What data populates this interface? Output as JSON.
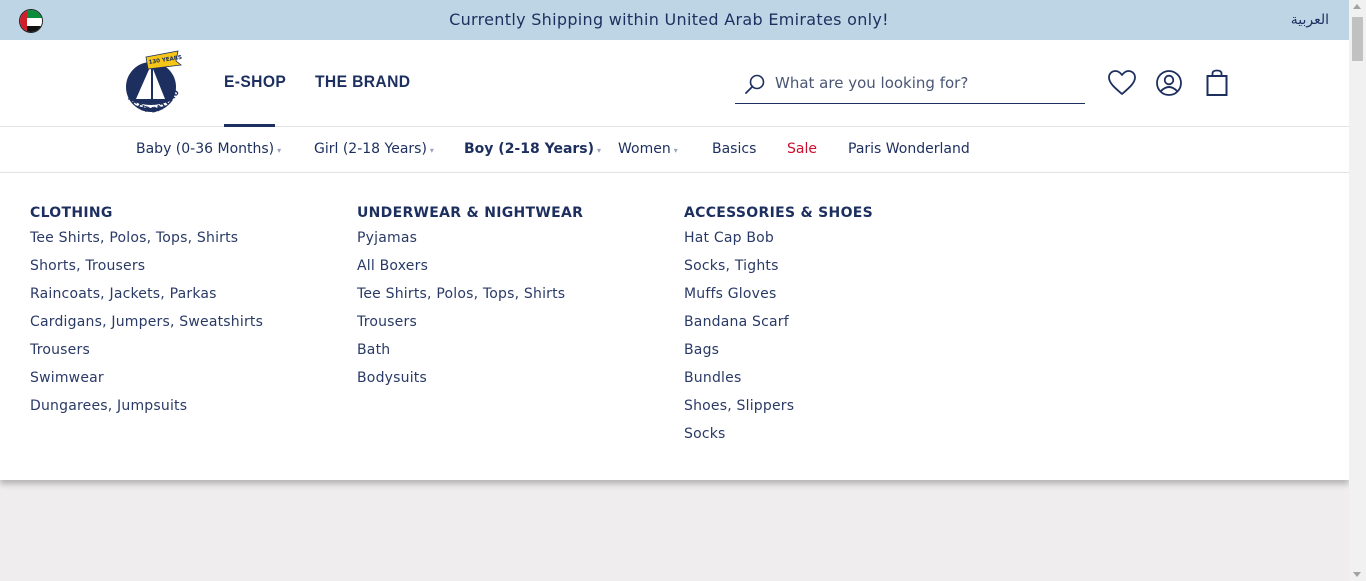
{
  "topbar": {
    "shipping_notice": "Currently Shipping within United Arab Emirates only!",
    "language_link": "العربية",
    "flag_icon": "uae-flag-icon"
  },
  "header": {
    "logo_text": "PETIT BATEAU",
    "logo_badge": "130 YEARS",
    "nav": [
      {
        "label": "E-SHOP",
        "active": true
      },
      {
        "label": "THE BRAND",
        "active": false
      }
    ],
    "search": {
      "placeholder": "What are you looking for?",
      "value": ""
    },
    "icons": [
      "search-icon",
      "wishlist-heart-icon",
      "account-icon",
      "cart-bag-icon"
    ]
  },
  "categories": [
    {
      "label": "Baby (0-36 Months)",
      "active": false,
      "has_dropdown": true
    },
    {
      "label": "Girl (2-18 Years)",
      "active": false,
      "has_dropdown": true
    },
    {
      "label": "Boy (2-18 Years)",
      "active": true,
      "has_dropdown": true
    },
    {
      "label": "Women",
      "active": false,
      "has_dropdown": true
    },
    {
      "label": "Basics",
      "active": false,
      "has_dropdown": false
    },
    {
      "label": "Sale",
      "active": false,
      "has_dropdown": false
    },
    {
      "label": "Paris Wonderland",
      "active": false,
      "has_dropdown": false
    }
  ],
  "mega_menu": {
    "columns": [
      {
        "heading": "CLOTHING",
        "items": [
          "Tee Shirts, Polos, Tops, Shirts",
          "Shorts, Trousers",
          "Raincoats, Jackets, Parkas",
          "Cardigans, Jumpers, Sweatshirts",
          "Trousers",
          "Swimwear",
          "Dungarees, Jumpsuits"
        ]
      },
      {
        "heading": "UNDERWEAR & NIGHTWEAR",
        "items": [
          "Pyjamas",
          "All Boxers",
          "Tee Shirts, Polos, Tops, Shirts",
          "Trousers",
          "Bath",
          "Bodysuits"
        ]
      },
      {
        "heading": "ACCESSORIES & SHOES",
        "items": [
          "Hat Cap Bob",
          "Socks, Tights",
          "Muffs Gloves",
          "Bandana Scarf",
          "Bags",
          "Bundles",
          "Shoes, Slippers",
          "Socks"
        ]
      }
    ]
  },
  "colors": {
    "navy": "#1d2f5e",
    "topbar_bg": "#bdd5e5",
    "sale_red": "#c8102e",
    "logo_yellow": "#f5c518"
  }
}
